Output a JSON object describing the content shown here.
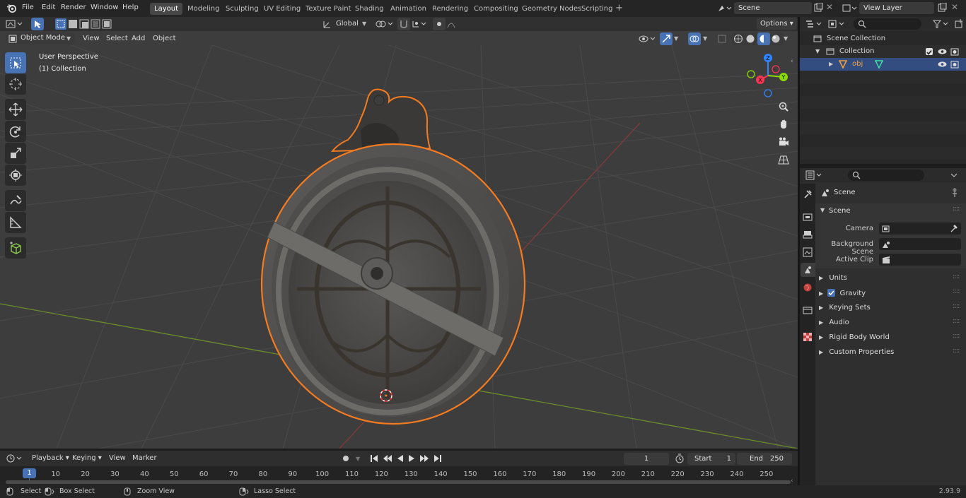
{
  "menu": [
    "File",
    "Edit",
    "Render",
    "Window",
    "Help"
  ],
  "workspaces": [
    "Layout",
    "Modeling",
    "Sculpting",
    "UV Editing",
    "Texture Paint",
    "Shading",
    "Animation",
    "Rendering",
    "Compositing",
    "Geometry Nodes",
    "Scripting"
  ],
  "scene_name": "Scene",
  "view_layer": "View Layer",
  "viewport": {
    "mode": "Object Mode",
    "menus": [
      "View",
      "Select",
      "Add",
      "Object"
    ],
    "orientation": "Global",
    "options": "Options",
    "overlay_title": "User Perspective",
    "overlay_collection": "(1) Collection",
    "gizmo": {
      "z": "Z",
      "y": "Y",
      "x": "X"
    }
  },
  "outliner": {
    "scene_collection": "Scene Collection",
    "collection": "Collection",
    "object": "obj"
  },
  "properties": {
    "title": "Scene",
    "section": "Scene",
    "camera_label": "Camera",
    "bg_scene_label": "Background Scene",
    "active_clip_label": "Active Clip",
    "panels": [
      "Units",
      "Gravity",
      "Keying Sets",
      "Audio",
      "Rigid Body World",
      "Custom Properties"
    ]
  },
  "timeline": {
    "menus": [
      "Playback",
      "Keying",
      "View",
      "Marker"
    ],
    "current_frame": "1",
    "start_label": "Start",
    "start": "1",
    "end_label": "End",
    "end": "250",
    "ticks": [
      "10",
      "20",
      "30",
      "40",
      "50",
      "60",
      "70",
      "80",
      "90",
      "100",
      "110",
      "120",
      "130",
      "140",
      "150",
      "160",
      "170",
      "180",
      "190",
      "200",
      "210",
      "220",
      "230",
      "240",
      "250"
    ],
    "playhead": "1"
  },
  "status": {
    "select": "Select",
    "box_select": "Box Select",
    "zoom_view": "Zoom View",
    "lasso_select": "Lasso Select",
    "version": "2.93.9"
  },
  "colors": {
    "accent": "#4772b3",
    "selection_outline": "#f47b20",
    "x_axis": "#ff3352",
    "y_axis": "#8bdc00",
    "z_axis": "#2f85ff"
  }
}
